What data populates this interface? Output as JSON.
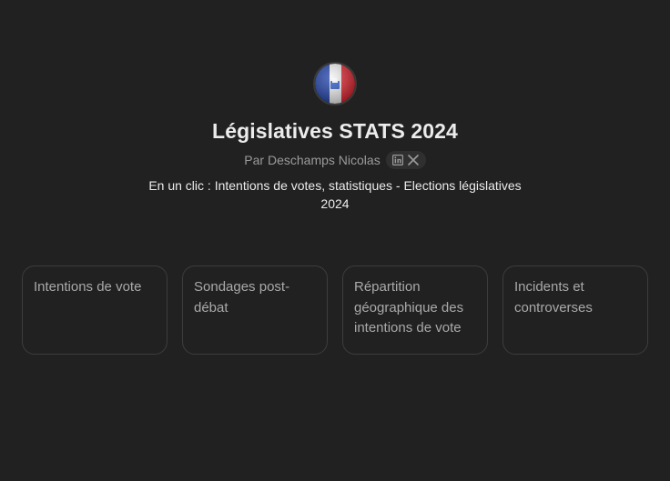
{
  "gpt": {
    "title": "Législatives STATS 2024",
    "author_prefix": "Par",
    "author": "Deschamps Nicolas",
    "description": "En un clic : Intentions de votes, statistiques - Elections législatives 2024",
    "social_icons": [
      "linkedin-icon",
      "x-icon"
    ]
  },
  "starters": [
    {
      "label": "Intentions de vote"
    },
    {
      "label": "Sondages post-débat"
    },
    {
      "label": "Répartition géographique des intentions de vote"
    },
    {
      "label": "Incidents et controverses"
    }
  ],
  "colors": {
    "background": "#212121",
    "card_border": "#3d3d3d",
    "flag_blue": "#1d3fa8",
    "flag_white": "#f4f4f4",
    "flag_red": "#e0242f"
  }
}
